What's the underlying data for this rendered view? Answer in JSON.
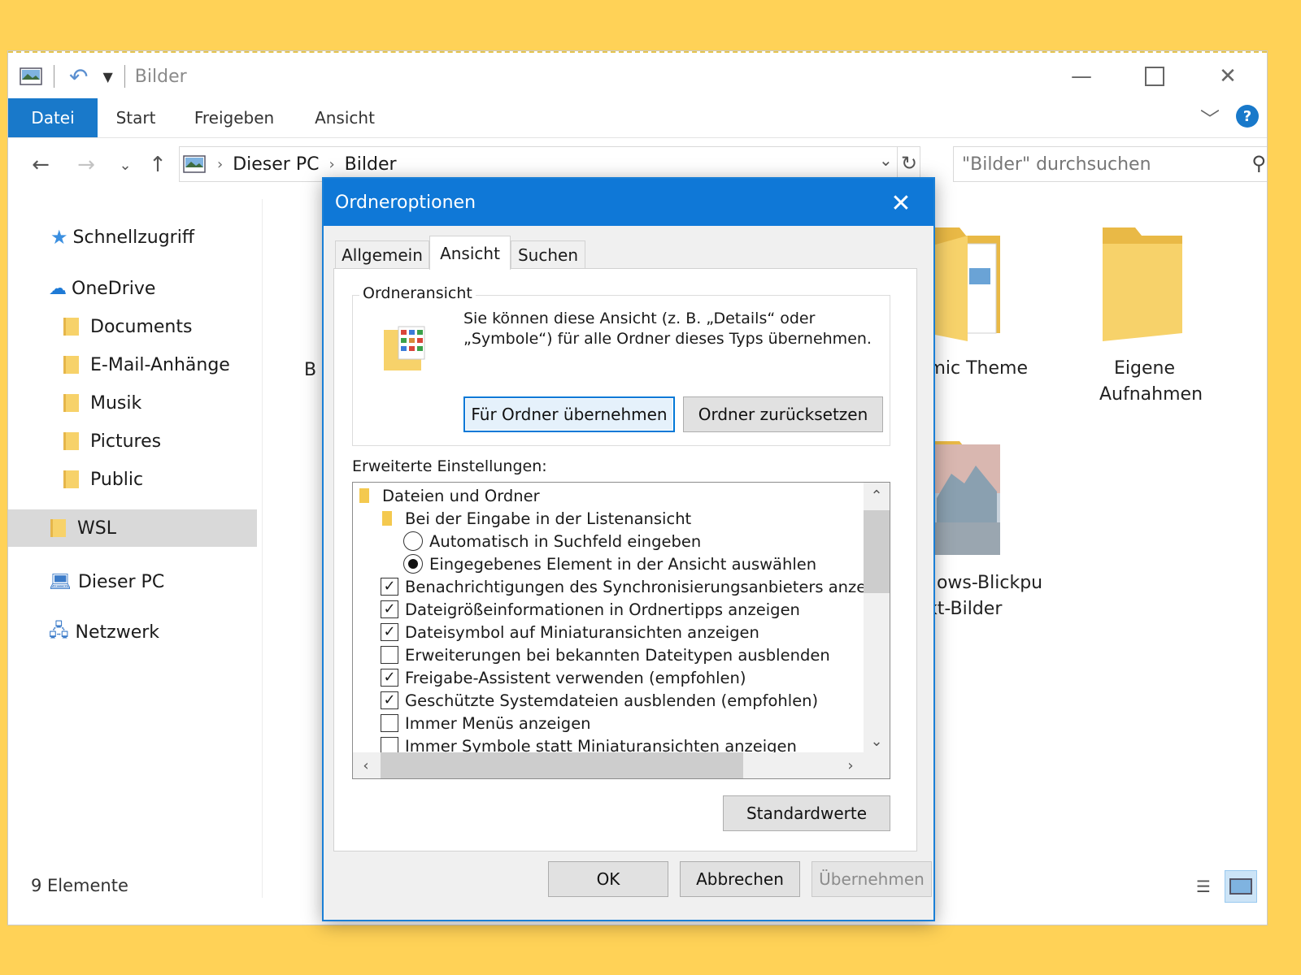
{
  "window": {
    "title": "Bilder",
    "ribbon_tabs": [
      "Datei",
      "Start",
      "Freigeben",
      "Ansicht"
    ],
    "help_label": "?"
  },
  "address": {
    "crumb1": "Dieser PC",
    "crumb2": "Bilder",
    "search_placeholder": "\"Bilder\" durchsuchen"
  },
  "sidebar": {
    "items": [
      {
        "label": "Schnellzugriff"
      },
      {
        "label": "OneDrive"
      },
      {
        "label": "Documents"
      },
      {
        "label": "E-Mail-Anhänge"
      },
      {
        "label": "Musik"
      },
      {
        "label": "Pictures"
      },
      {
        "label": "Public"
      },
      {
        "label": "WSL"
      },
      {
        "label": "Dieser PC"
      },
      {
        "label": "Netzwerk"
      }
    ]
  },
  "content": {
    "partial_letter": "B",
    "tile_dynamic_theme": "amic Theme",
    "tile_eigene_1": "Eigene",
    "tile_eigene_2": "Aufnahmen",
    "tile_blick_1": "dows-Blickpu",
    "tile_blick_2": "kt-Bilder"
  },
  "status": {
    "count": "9 Elemente"
  },
  "dialog": {
    "title": "Ordneroptionen",
    "tabs": [
      "Allgemein",
      "Ansicht",
      "Suchen"
    ],
    "group_title": "Ordneransicht",
    "group_text": "Sie können diese Ansicht (z. B. „Details“ oder „Symbole“) für alle Ordner dieses Typs übernehmen.",
    "btn_apply_folders": "Für Ordner übernehmen",
    "btn_reset_folders": "Ordner zurücksetzen",
    "advanced_label": "Erweiterte Einstellungen:",
    "advanced_items": [
      {
        "label": "Dateien und Ordner",
        "type": "folder"
      },
      {
        "label": "Bei der Eingabe in der Listenansicht",
        "type": "folder"
      },
      {
        "label": "Automatisch in Suchfeld eingeben",
        "type": "radio",
        "checked": false
      },
      {
        "label": "Eingegebenes Element in der Ansicht auswählen",
        "type": "radio",
        "checked": true
      },
      {
        "label": "Benachrichtigungen des Synchronisierungsanbieters anzeig",
        "type": "checkbox",
        "checked": true
      },
      {
        "label": "Dateigrößeinformationen in Ordnertipps anzeigen",
        "type": "checkbox",
        "checked": true
      },
      {
        "label": "Dateisymbol auf Miniaturansichten anzeigen",
        "type": "checkbox",
        "checked": true
      },
      {
        "label": "Erweiterungen bei bekannten Dateitypen ausblenden",
        "type": "checkbox",
        "checked": false
      },
      {
        "label": "Freigabe-Assistent verwenden (empfohlen)",
        "type": "checkbox",
        "checked": true
      },
      {
        "label": "Geschützte Systemdateien ausblenden (empfohlen)",
        "type": "checkbox",
        "checked": true
      },
      {
        "label": "Immer Menüs anzeigen",
        "type": "checkbox",
        "checked": false
      },
      {
        "label": "Immer Symbole statt Miniaturansichten anzeigen",
        "type": "checkbox",
        "checked": false
      }
    ],
    "btn_defaults": "Standardwerte",
    "btn_ok": "OK",
    "btn_cancel": "Abbrechen",
    "btn_apply": "Übernehmen"
  },
  "colors": {
    "accent": "#0f78d7",
    "background": "#ffd257",
    "folder": "#f7d26a"
  }
}
